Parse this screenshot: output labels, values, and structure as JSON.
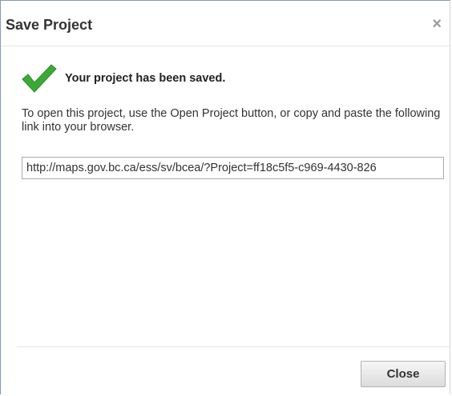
{
  "dialog": {
    "title": "Save Project",
    "close_glyph": "×",
    "check_icon": "check-icon",
    "saved_message": "Your project has been saved.",
    "instructions": "To open this project, use the Open Project button, or copy and paste the following link into your browser.",
    "link_value": "http://maps.gov.bc.ca/ess/sv/bcea/?Project=ff18c5f5-c969-4430-826",
    "close_button_label": "Close",
    "accent_color": "#3aaa35"
  }
}
